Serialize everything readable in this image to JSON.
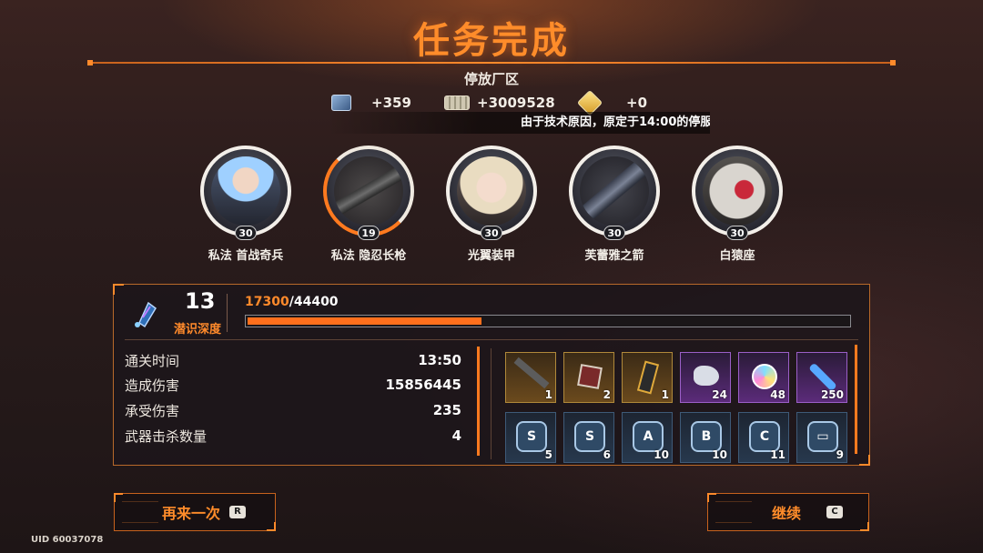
{
  "header": {
    "title": "任务完成",
    "zone": "停放厂区"
  },
  "resources": [
    {
      "icon": "supply-crate-icon",
      "value": "+359"
    },
    {
      "icon": "cash-stack-icon",
      "value": "+3009528"
    },
    {
      "icon": "crystal-token-icon",
      "value": "+0"
    }
  ],
  "notice": "由于技术原因，原定于14:00的停服",
  "team": [
    {
      "name": "私法 首战奇兵",
      "level": "30",
      "portrait": "blue-hair-character-portrait"
    },
    {
      "name": "私法 隐忍长枪",
      "level": "19",
      "portrait": "assault-rifle-weapon-portrait"
    },
    {
      "name": "光翼装甲",
      "level": "30",
      "portrait": "blonde-character-portrait"
    },
    {
      "name": "芙蕾雅之箭",
      "level": "30",
      "portrait": "sniper-rifle-weapon-portrait"
    },
    {
      "name": "白猿座",
      "level": "30",
      "portrait": "mecha-helmet-portrait"
    }
  ],
  "depth": {
    "level": "13",
    "label": "潜识深度",
    "xp_current": "17300",
    "xp_separator": "/",
    "xp_max": "44400",
    "xp_fraction": 0.39
  },
  "stats": [
    {
      "label": "通关时间",
      "value": "13:50"
    },
    {
      "label": "造成伤害",
      "value": "15856445"
    },
    {
      "label": "承受伤害",
      "value": "235"
    },
    {
      "label": "武器击杀数量",
      "value": "4"
    }
  ],
  "rewards_row1": [
    {
      "icon": "weapon-blueprint-icon",
      "count": "1",
      "quality": "gold"
    },
    {
      "icon": "chip-module-icon",
      "count": "2",
      "quality": "gold"
    },
    {
      "icon": "data-card-icon",
      "count": "1",
      "quality": "gold"
    },
    {
      "icon": "ore-crystal-icon",
      "count": "24",
      "quality": "purple"
    },
    {
      "icon": "data-disc-icon",
      "count": "48",
      "quality": "purple"
    },
    {
      "icon": "syringe-icon",
      "count": "250",
      "quality": "purple"
    }
  ],
  "rewards_row2": [
    {
      "icon": "chip-s-icon",
      "glyph": "S",
      "count": "5"
    },
    {
      "icon": "chip-s-icon",
      "glyph": "S",
      "count": "6"
    },
    {
      "icon": "chip-a-icon",
      "glyph": "A",
      "count": "10"
    },
    {
      "icon": "chip-b-icon",
      "glyph": "B",
      "count": "10"
    },
    {
      "icon": "chip-c-icon",
      "glyph": "C",
      "count": "11"
    },
    {
      "icon": "chip-card-icon",
      "glyph": "▭",
      "count": "9"
    }
  ],
  "buttons": {
    "retry": {
      "label": "再来一次",
      "key": "R"
    },
    "continue": {
      "label": "继续",
      "key": "C"
    }
  },
  "uid": "UID 60037078",
  "colors": {
    "accent": "#ff8a2b",
    "panel_border": "#b8692a",
    "gold": "#b0893a",
    "purple": "#9b5fc8"
  }
}
